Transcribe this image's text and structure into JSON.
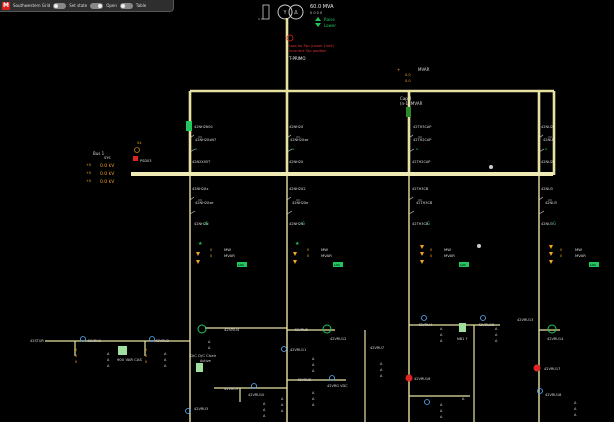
{
  "toolbar": {
    "left_label": "Southwestern Grid",
    "toggles": [
      {
        "label": "Set state",
        "on": false
      },
      {
        "label": "Open",
        "on": true
      },
      {
        "label": "Table",
        "on": false
      }
    ]
  },
  "transformer": {
    "rating": "60.0 MVA",
    "sub1": "0 0 0 0",
    "green1": "Raise",
    "green2": "Lower",
    "alarm_lines": [
      "Loss for Tap (Lower Limit)",
      "Incorrect Tap position"
    ],
    "name": "T-PRIMO"
  },
  "busbar": {
    "label1": "Bus 1",
    "label2": "SYS",
    "kv_labels": [
      "0.0 kV",
      "0.0 kV",
      "0.0 kV"
    ],
    "prefix": "S4",
    "node": "PSD03"
  },
  "cap": {
    "name1": "Cap 2",
    "name2": "(n-1) MVAR",
    "feeder": "42TH3CAP"
  },
  "mvar_top": {
    "value": "MVAR"
  },
  "feeders_upper": [
    {
      "breaker": "42NH2N01",
      "label1": "42NH2XxN7",
      "label2": "42N2X05T"
    },
    {
      "breaker": "42NH2X",
      "label1": "42NH2Xxe",
      "label2": "42NH2X"
    },
    {
      "breaker": "42TH2CAP",
      "label1": "42TH2CAP",
      "label2": "42TH2CAP"
    },
    {
      "breaker": "42NU2",
      "label1": "42NU2",
      "label2": "42NU2"
    }
  ],
  "feeders_lower": [
    {
      "breaker": "42NH2Xx",
      "label": "42NH2Xxe",
      "name": "42NH2N"
    },
    {
      "breaker": "42NH2X2",
      "label": "42NH2Xe",
      "name": "42NH2N"
    },
    {
      "breaker": "42TH3CB",
      "label": "42TH3CB",
      "name": "42TH3CB"
    },
    {
      "breaker": "42NU3",
      "label": "42NU3",
      "name": "42NU3"
    }
  ],
  "meters": [
    {
      "mw": "MW",
      "mvar": "MVAR",
      "ind": "LOC"
    },
    {
      "mw": "MW",
      "mvar": "MVAR",
      "ind": "LOC"
    },
    {
      "mw": "MW",
      "mvar": "MVAR",
      "ind": "LOC"
    },
    {
      "mw": "MW",
      "mvar": "MVAR",
      "ind": "LOC"
    }
  ],
  "bottom": {
    "left_tag": "42STUR",
    "vr1": "42VRU1",
    "vr2": "42VRU2",
    "vr3": "42VRU3",
    "vr4": "42VRU4",
    "cap_label": "900 VAR CAS",
    "chair_label1": "D/C O/C Chair",
    "chair_label2": "Active",
    "sw1": "42VRU4",
    "sw2": "42VRU5",
    "sw3": "42VRU11",
    "sw4": "42VRU12",
    "sw5": "42VRU7",
    "sw6": "42VRU8",
    "sw7": "42VRU9",
    "sw8": "42VRU10",
    "sw9": "42VRU13",
    "sw10": "42VRU14",
    "sw11": "42VRU15",
    "vdc": "42VRG VDC",
    "xx": "42VRU16",
    "nbt": "NB1 7",
    "k": "42VRU17",
    "n1": "42VRU18"
  }
}
